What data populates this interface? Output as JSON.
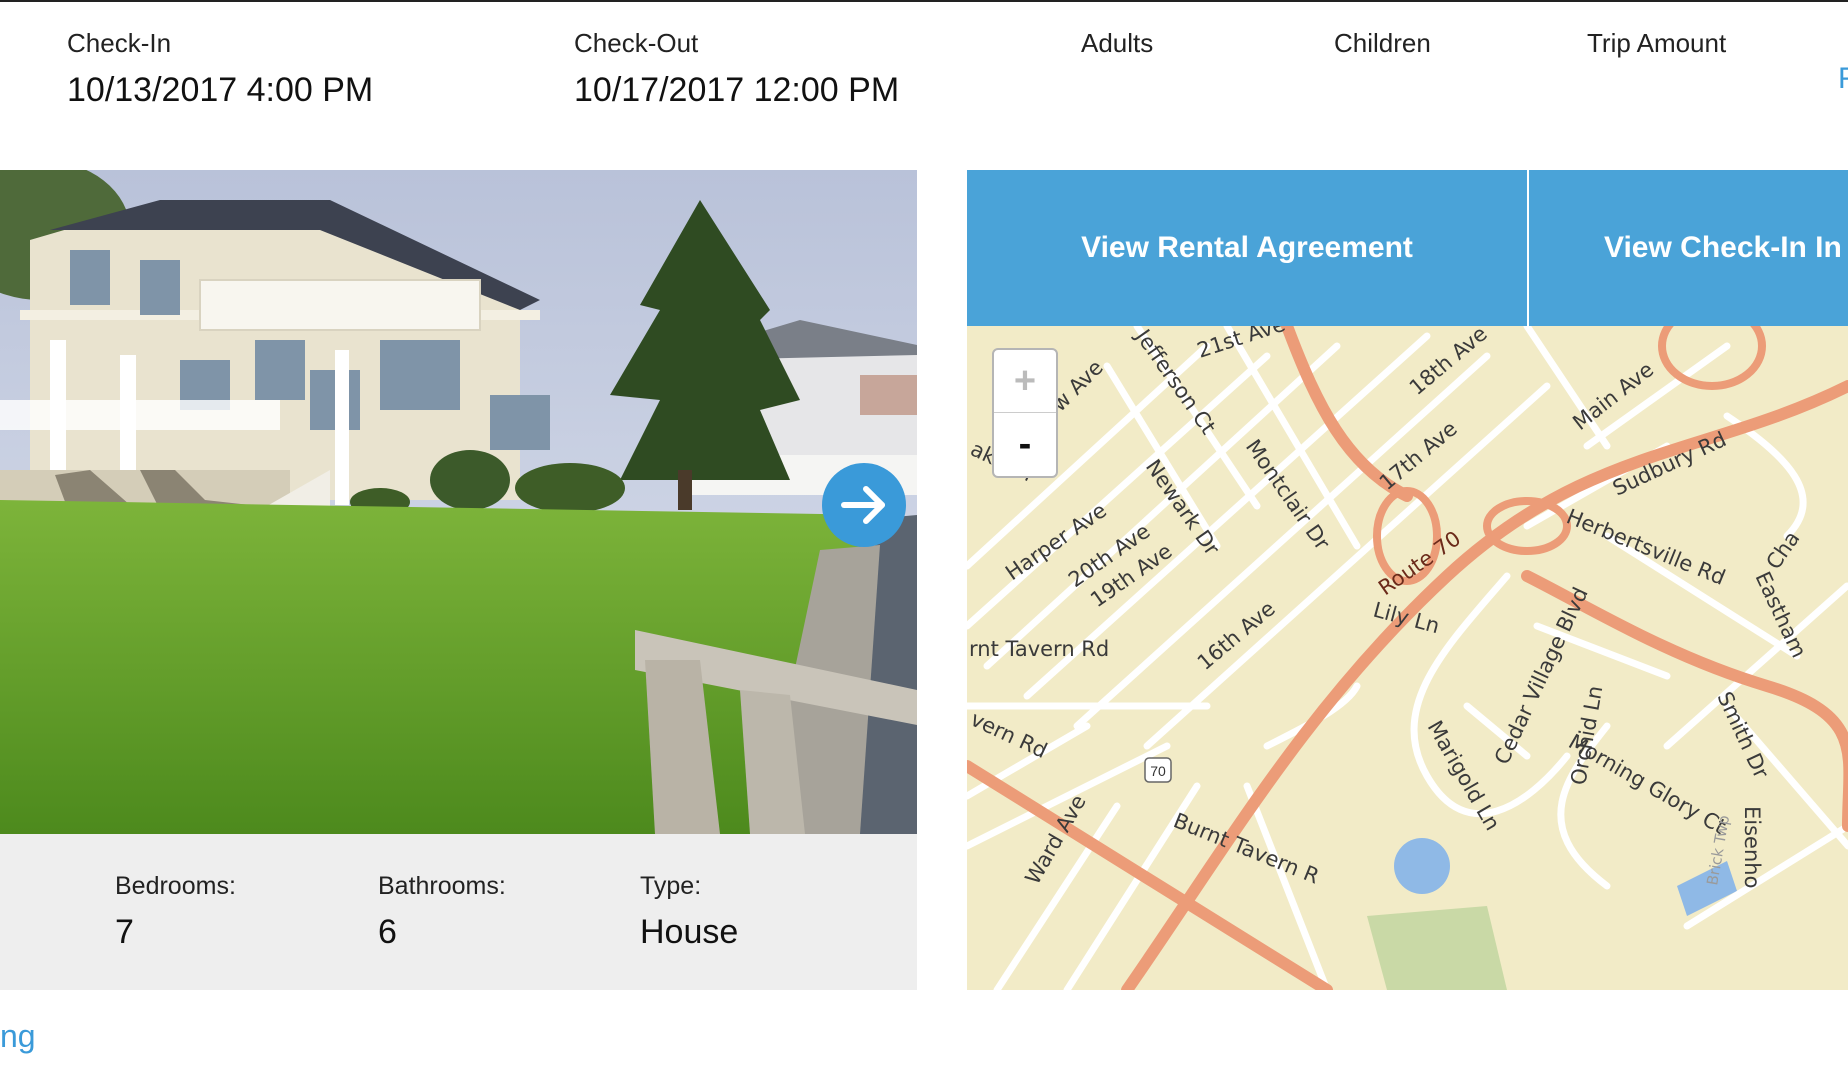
{
  "trip": {
    "check_in": {
      "label": "Check-In",
      "value": "10/13/2017 4:00 PM"
    },
    "check_out": {
      "label": "Check-Out",
      "value": "10/17/2017 12:00 PM"
    },
    "adults": {
      "label": "Adults"
    },
    "children": {
      "label": "Children"
    },
    "trip_amount": {
      "label": "Trip Amount"
    },
    "edge_link_text": "F"
  },
  "property": {
    "bedrooms": {
      "label": "Bedrooms:",
      "value": "7"
    },
    "bathrooms": {
      "label": "Bathrooms:",
      "value": "6"
    },
    "type": {
      "label": "Type:",
      "value": "House"
    }
  },
  "actions": {
    "rental_agreement": "View Rental Agreement",
    "check_in_info": "View Check-In In"
  },
  "map": {
    "zoom_in": "+",
    "zoom_out": "-",
    "labels": {
      "st21": "21st Ave",
      "jefferson": "Jefferson Ct",
      "ave18": "18th Ave",
      "main": "Main Ave",
      "ave17": "17th Ave",
      "sudbury": "Sudbury Rd",
      "harper": "Harper Ave",
      "ave20": "20th Ave",
      "ave19": "19th Ave",
      "newark": "Newark Dr",
      "montclair": "Montclair Dr",
      "herbertsville": "Herbertsville Rd",
      "route70": "Route 70",
      "lily": "Lily Ln",
      "ave16": "16th Ave",
      "tavern_left": "rnt Tavern Rd",
      "marigold": "Marigold Ln",
      "cedar": "Cedar Village Blvd",
      "orchid": "Orchid Ln",
      "morning": "Morning Glory Ct",
      "smith": "Smith Dr",
      "burnt": "Burnt Tavern R",
      "ward": "Ward Ave",
      "avern": "vern Rd",
      "low": "low Ave",
      "lake": "ake Dr",
      "eastham": "Eastham",
      "cha": "Cha",
      "eisenho": "Eisenho",
      "brick": "Brick Twp",
      "shield": "70"
    }
  },
  "footer": {
    "link_text": "ng"
  }
}
